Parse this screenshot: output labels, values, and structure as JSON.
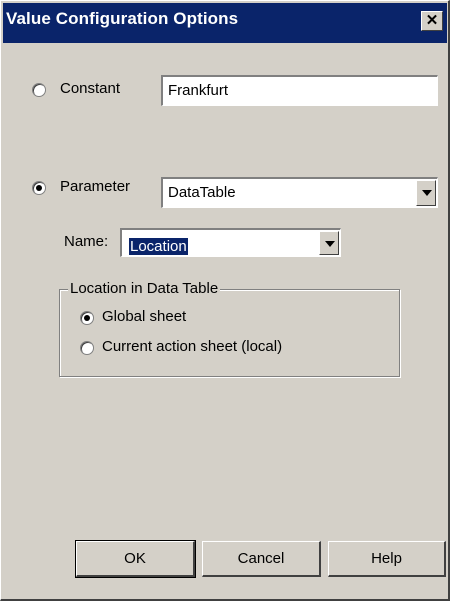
{
  "window": {
    "title": "Value Configuration Options",
    "close_label": "✕"
  },
  "constant": {
    "label": "Constant",
    "value": "Frankfurt"
  },
  "parameter": {
    "label": "Parameter",
    "type_value": "DataTable"
  },
  "name": {
    "label": "Name:",
    "value": "Location"
  },
  "location_group": {
    "title": "Location in Data Table",
    "options": [
      {
        "label": "Global sheet",
        "selected": true
      },
      {
        "label": "Current action sheet (local)",
        "selected": false
      }
    ]
  },
  "buttons": {
    "ok": "OK",
    "cancel": "Cancel",
    "help": "Help"
  }
}
